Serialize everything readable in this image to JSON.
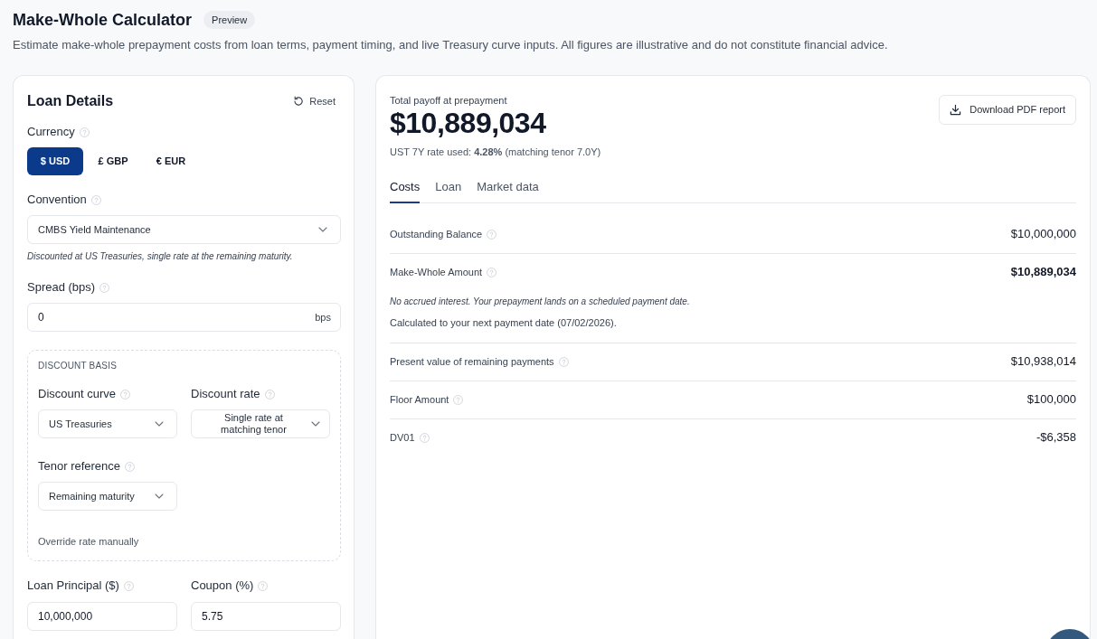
{
  "header": {
    "title": "Make-Whole Calculator",
    "badge": "Preview",
    "subtitle": "Estimate make-whole prepayment costs from loan terms, payment timing, and live Treasury curve inputs. All figures are illustrative and do not constitute financial advice."
  },
  "loan_details": {
    "title": "Loan Details",
    "reset_label": "Reset",
    "currency": {
      "label": "Currency",
      "options": [
        {
          "label": "$ USD",
          "selected": true
        },
        {
          "label": "£ GBP",
          "selected": false
        },
        {
          "label": "€ EUR",
          "selected": false
        }
      ]
    },
    "convention": {
      "label": "Convention",
      "value": "CMBS Yield Maintenance",
      "note": "Discounted at US Treasuries, single rate at the remaining maturity."
    },
    "spread": {
      "label": "Spread (bps)",
      "value": "0",
      "suffix": "bps"
    },
    "discount_basis": {
      "heading": "DISCOUNT BASIS",
      "fields": [
        {
          "label": "Discount curve",
          "value": "US Treasuries"
        },
        {
          "label": "Discount rate",
          "value": "Single rate at matching tenor"
        },
        {
          "label": "Tenor reference",
          "value": "Remaining maturity"
        }
      ],
      "override_label": "Override rate manually"
    },
    "inputs": [
      {
        "label": "Loan Principal ($)",
        "value": "10,000,000"
      },
      {
        "label": "Coupon (%)",
        "value": "5.75"
      }
    ]
  },
  "results": {
    "total_label": "Total payoff at prepayment",
    "total_value": "$10,889,034",
    "rate_note": "UST 7Y rate used: **4.28%** (matching tenor 7.0Y)",
    "download_label": "Download PDF report",
    "tabs": [
      {
        "label": "Costs",
        "selected": true
      },
      {
        "label": "Loan",
        "selected": false
      },
      {
        "label": "Market data",
        "selected": false
      }
    ],
    "rows": [
      {
        "label": "Outstanding Balance",
        "value": "$10,000,000",
        "emphasized": false
      },
      {
        "label": "Make-Whole Amount",
        "value": "$10,889,034",
        "emphasized": true,
        "notes": [
          {
            "kind": "italic",
            "text": "No accrued interest. Your prepayment lands on a scheduled payment date."
          },
          {
            "kind": "plain",
            "text": "Calculated to your next payment date (07/02/2026)."
          }
        ]
      },
      {
        "label": "Present value of remaining payments",
        "value": "$10,938,014",
        "emphasized": false
      },
      {
        "label": "Floor Amount",
        "value": "$100,000",
        "emphasized": false
      },
      {
        "label": "DV01",
        "value": "-$6,358",
        "emphasized": false
      }
    ]
  }
}
